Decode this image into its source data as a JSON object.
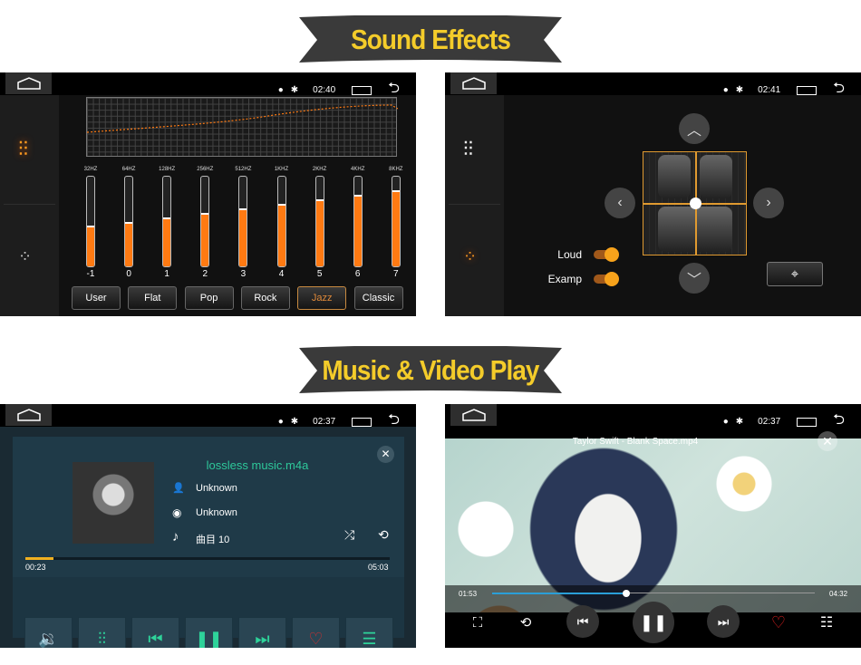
{
  "banners": {
    "top": "Sound Effects",
    "middle": "Music & Video Play"
  },
  "colors": {
    "accent_orange": "#ff7a12",
    "music_green": "#2ed39a",
    "banner_text": "#f4cc2a",
    "banner_bg": "#3a3a3a",
    "video_progress": "#2a9fd8"
  },
  "equalizer": {
    "status_time": "02:40",
    "bands": [
      {
        "freq": "32HZ",
        "value": -1
      },
      {
        "freq": "64HZ",
        "value": 0
      },
      {
        "freq": "128HZ",
        "value": 1
      },
      {
        "freq": "256HZ",
        "value": 2
      },
      {
        "freq": "512HZ",
        "value": 3
      },
      {
        "freq": "1KHZ",
        "value": 4
      },
      {
        "freq": "2KHZ",
        "value": 5
      },
      {
        "freq": "4KHZ",
        "value": 6
      },
      {
        "freq": "8KHZ",
        "value": 7
      }
    ],
    "value_range": [
      -10,
      10
    ],
    "presets": [
      "User",
      "Flat",
      "Pop",
      "Rock",
      "Jazz",
      "Classic"
    ],
    "active_preset": "Jazz"
  },
  "balance": {
    "status_time": "02:41",
    "loud_label": "Loud",
    "loud_on": true,
    "examp_label": "Examp",
    "examp_on": true
  },
  "music": {
    "status_time": "02:37",
    "title": "lossless music.m4a",
    "artist": "Unknown",
    "album": "Unknown",
    "track": "曲目 10",
    "elapsed": "00:23",
    "duration": "05:03",
    "progress": 0.076
  },
  "video": {
    "status_time": "02:37",
    "title": "Taylor Swift - Blank Space.mp4",
    "elapsed": "01:53",
    "duration": "04:32",
    "progress": 0.415
  }
}
